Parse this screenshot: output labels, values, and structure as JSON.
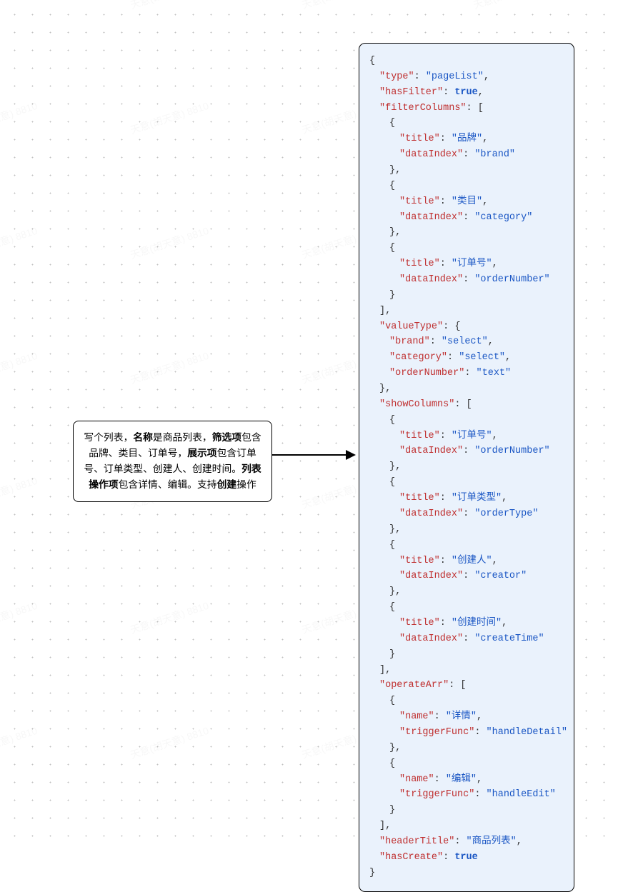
{
  "watermark_text": "天意(胡天意) 8810",
  "left_box": {
    "parts": [
      {
        "t": "写个列表，",
        "b": false
      },
      {
        "t": "名称",
        "b": true
      },
      {
        "t": "是商品列表，",
        "b": false
      },
      {
        "t": "筛选项",
        "b": true
      },
      {
        "t": "包含品牌、类目、订单号，",
        "b": false
      },
      {
        "t": "展示项",
        "b": true
      },
      {
        "t": "包含订单号、订单类型、创建人、创建时间。",
        "b": false
      },
      {
        "t": "列表操作项",
        "b": true
      },
      {
        "t": "包含详情、编辑。支持",
        "b": false
      },
      {
        "t": "创建",
        "b": true
      },
      {
        "t": "操作",
        "b": false
      }
    ]
  },
  "code": {
    "lines": [
      {
        "i": 0,
        "seg": [
          {
            "c": "p",
            "t": "{"
          }
        ]
      },
      {
        "i": 1,
        "seg": [
          {
            "c": "k",
            "t": "\"type\""
          },
          {
            "c": "p",
            "t": ": "
          },
          {
            "c": "s",
            "t": "\"pageList\""
          },
          {
            "c": "p",
            "t": ","
          }
        ]
      },
      {
        "i": 1,
        "seg": [
          {
            "c": "k",
            "t": "\"hasFilter\""
          },
          {
            "c": "p",
            "t": ": "
          },
          {
            "c": "b",
            "t": "true"
          },
          {
            "c": "p",
            "t": ","
          }
        ]
      },
      {
        "i": 1,
        "seg": [
          {
            "c": "k",
            "t": "\"filterColumns\""
          },
          {
            "c": "p",
            "t": ": ["
          }
        ]
      },
      {
        "i": 2,
        "seg": [
          {
            "c": "p",
            "t": "{"
          }
        ]
      },
      {
        "i": 3,
        "seg": [
          {
            "c": "k",
            "t": "\"title\""
          },
          {
            "c": "p",
            "t": ": "
          },
          {
            "c": "s",
            "t": "\"品牌\""
          },
          {
            "c": "p",
            "t": ","
          }
        ]
      },
      {
        "i": 3,
        "seg": [
          {
            "c": "k",
            "t": "\"dataIndex\""
          },
          {
            "c": "p",
            "t": ": "
          },
          {
            "c": "s",
            "t": "\"brand\""
          }
        ]
      },
      {
        "i": 2,
        "seg": [
          {
            "c": "p",
            "t": "},"
          }
        ]
      },
      {
        "i": 2,
        "seg": [
          {
            "c": "p",
            "t": "{"
          }
        ]
      },
      {
        "i": 3,
        "seg": [
          {
            "c": "k",
            "t": "\"title\""
          },
          {
            "c": "p",
            "t": ": "
          },
          {
            "c": "s",
            "t": "\"类目\""
          },
          {
            "c": "p",
            "t": ","
          }
        ]
      },
      {
        "i": 3,
        "seg": [
          {
            "c": "k",
            "t": "\"dataIndex\""
          },
          {
            "c": "p",
            "t": ": "
          },
          {
            "c": "s",
            "t": "\"category\""
          }
        ]
      },
      {
        "i": 2,
        "seg": [
          {
            "c": "p",
            "t": "},"
          }
        ]
      },
      {
        "i": 2,
        "seg": [
          {
            "c": "p",
            "t": "{"
          }
        ]
      },
      {
        "i": 3,
        "seg": [
          {
            "c": "k",
            "t": "\"title\""
          },
          {
            "c": "p",
            "t": ": "
          },
          {
            "c": "s",
            "t": "\"订单号\""
          },
          {
            "c": "p",
            "t": ","
          }
        ]
      },
      {
        "i": 3,
        "seg": [
          {
            "c": "k",
            "t": "\"dataIndex\""
          },
          {
            "c": "p",
            "t": ": "
          },
          {
            "c": "s",
            "t": "\"orderNumber\""
          }
        ]
      },
      {
        "i": 2,
        "seg": [
          {
            "c": "p",
            "t": "}"
          }
        ]
      },
      {
        "i": 1,
        "seg": [
          {
            "c": "p",
            "t": "],"
          }
        ]
      },
      {
        "i": 1,
        "seg": [
          {
            "c": "k",
            "t": "\"valueType\""
          },
          {
            "c": "p",
            "t": ": {"
          }
        ]
      },
      {
        "i": 2,
        "seg": [
          {
            "c": "k",
            "t": "\"brand\""
          },
          {
            "c": "p",
            "t": ": "
          },
          {
            "c": "s",
            "t": "\"select\""
          },
          {
            "c": "p",
            "t": ","
          }
        ]
      },
      {
        "i": 2,
        "seg": [
          {
            "c": "k",
            "t": "\"category\""
          },
          {
            "c": "p",
            "t": ": "
          },
          {
            "c": "s",
            "t": "\"select\""
          },
          {
            "c": "p",
            "t": ","
          }
        ]
      },
      {
        "i": 2,
        "seg": [
          {
            "c": "k",
            "t": "\"orderNumber\""
          },
          {
            "c": "p",
            "t": ": "
          },
          {
            "c": "s",
            "t": "\"text\""
          }
        ]
      },
      {
        "i": 1,
        "seg": [
          {
            "c": "p",
            "t": "},"
          }
        ]
      },
      {
        "i": 1,
        "seg": [
          {
            "c": "k",
            "t": "\"showColumns\""
          },
          {
            "c": "p",
            "t": ": ["
          }
        ]
      },
      {
        "i": 2,
        "seg": [
          {
            "c": "p",
            "t": "{"
          }
        ]
      },
      {
        "i": 3,
        "seg": [
          {
            "c": "k",
            "t": "\"title\""
          },
          {
            "c": "p",
            "t": ": "
          },
          {
            "c": "s",
            "t": "\"订单号\""
          },
          {
            "c": "p",
            "t": ","
          }
        ]
      },
      {
        "i": 3,
        "seg": [
          {
            "c": "k",
            "t": "\"dataIndex\""
          },
          {
            "c": "p",
            "t": ": "
          },
          {
            "c": "s",
            "t": "\"orderNumber\""
          }
        ]
      },
      {
        "i": 2,
        "seg": [
          {
            "c": "p",
            "t": "},"
          }
        ]
      },
      {
        "i": 2,
        "seg": [
          {
            "c": "p",
            "t": "{"
          }
        ]
      },
      {
        "i": 3,
        "seg": [
          {
            "c": "k",
            "t": "\"title\""
          },
          {
            "c": "p",
            "t": ": "
          },
          {
            "c": "s",
            "t": "\"订单类型\""
          },
          {
            "c": "p",
            "t": ","
          }
        ]
      },
      {
        "i": 3,
        "seg": [
          {
            "c": "k",
            "t": "\"dataIndex\""
          },
          {
            "c": "p",
            "t": ": "
          },
          {
            "c": "s",
            "t": "\"orderType\""
          }
        ]
      },
      {
        "i": 2,
        "seg": [
          {
            "c": "p",
            "t": "},"
          }
        ]
      },
      {
        "i": 2,
        "seg": [
          {
            "c": "p",
            "t": "{"
          }
        ]
      },
      {
        "i": 3,
        "seg": [
          {
            "c": "k",
            "t": "\"title\""
          },
          {
            "c": "p",
            "t": ": "
          },
          {
            "c": "s",
            "t": "\"创建人\""
          },
          {
            "c": "p",
            "t": ","
          }
        ]
      },
      {
        "i": 3,
        "seg": [
          {
            "c": "k",
            "t": "\"dataIndex\""
          },
          {
            "c": "p",
            "t": ": "
          },
          {
            "c": "s",
            "t": "\"creator\""
          }
        ]
      },
      {
        "i": 2,
        "seg": [
          {
            "c": "p",
            "t": "},"
          }
        ]
      },
      {
        "i": 2,
        "seg": [
          {
            "c": "p",
            "t": "{"
          }
        ]
      },
      {
        "i": 3,
        "seg": [
          {
            "c": "k",
            "t": "\"title\""
          },
          {
            "c": "p",
            "t": ": "
          },
          {
            "c": "s",
            "t": "\"创建时间\""
          },
          {
            "c": "p",
            "t": ","
          }
        ]
      },
      {
        "i": 3,
        "seg": [
          {
            "c": "k",
            "t": "\"dataIndex\""
          },
          {
            "c": "p",
            "t": ": "
          },
          {
            "c": "s",
            "t": "\"createTime\""
          }
        ]
      },
      {
        "i": 2,
        "seg": [
          {
            "c": "p",
            "t": "}"
          }
        ]
      },
      {
        "i": 1,
        "seg": [
          {
            "c": "p",
            "t": "],"
          }
        ]
      },
      {
        "i": 1,
        "seg": [
          {
            "c": "k",
            "t": "\"operateArr\""
          },
          {
            "c": "p",
            "t": ": ["
          }
        ]
      },
      {
        "i": 2,
        "seg": [
          {
            "c": "p",
            "t": "{"
          }
        ]
      },
      {
        "i": 3,
        "seg": [
          {
            "c": "k",
            "t": "\"name\""
          },
          {
            "c": "p",
            "t": ": "
          },
          {
            "c": "s",
            "t": "\"详情\""
          },
          {
            "c": "p",
            "t": ","
          }
        ]
      },
      {
        "i": 3,
        "seg": [
          {
            "c": "k",
            "t": "\"triggerFunc\""
          },
          {
            "c": "p",
            "t": ": "
          },
          {
            "c": "s",
            "t": "\"handleDetail\""
          }
        ]
      },
      {
        "i": 2,
        "seg": [
          {
            "c": "p",
            "t": "},"
          }
        ]
      },
      {
        "i": 2,
        "seg": [
          {
            "c": "p",
            "t": "{"
          }
        ]
      },
      {
        "i": 3,
        "seg": [
          {
            "c": "k",
            "t": "\"name\""
          },
          {
            "c": "p",
            "t": ": "
          },
          {
            "c": "s",
            "t": "\"编辑\""
          },
          {
            "c": "p",
            "t": ","
          }
        ]
      },
      {
        "i": 3,
        "seg": [
          {
            "c": "k",
            "t": "\"triggerFunc\""
          },
          {
            "c": "p",
            "t": ": "
          },
          {
            "c": "s",
            "t": "\"handleEdit\""
          }
        ]
      },
      {
        "i": 2,
        "seg": [
          {
            "c": "p",
            "t": "}"
          }
        ]
      },
      {
        "i": 1,
        "seg": [
          {
            "c": "p",
            "t": "],"
          }
        ]
      },
      {
        "i": 1,
        "seg": [
          {
            "c": "k",
            "t": "\"headerTitle\""
          },
          {
            "c": "p",
            "t": ": "
          },
          {
            "c": "s",
            "t": "\"商品列表\""
          },
          {
            "c": "p",
            "t": ","
          }
        ]
      },
      {
        "i": 1,
        "seg": [
          {
            "c": "k",
            "t": "\"hasCreate\""
          },
          {
            "c": "p",
            "t": ": "
          },
          {
            "c": "b",
            "t": "true"
          }
        ]
      },
      {
        "i": 0,
        "seg": [
          {
            "c": "p",
            "t": "}"
          }
        ]
      }
    ]
  }
}
